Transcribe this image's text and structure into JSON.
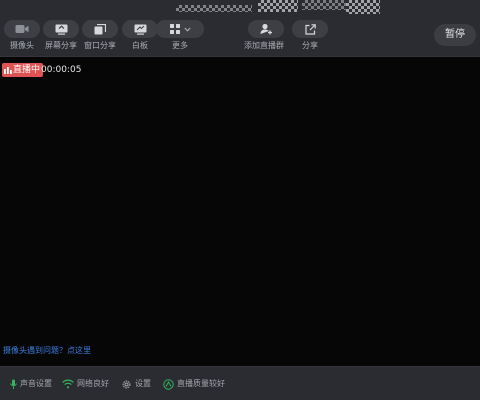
{
  "toolbar": {
    "buttons": [
      {
        "label": "摄像头",
        "icon": "camera-icon"
      },
      {
        "label": "屏幕分享",
        "icon": "screen-share-icon"
      },
      {
        "label": "窗口分享",
        "icon": "window-share-icon"
      },
      {
        "label": "白板",
        "icon": "whiteboard-icon"
      },
      {
        "label": "更多",
        "icon": "grid-icon"
      }
    ],
    "add_group_label": "添加直播群",
    "share_label": "分享",
    "pause_label": "暂停"
  },
  "live": {
    "badge_label": "直播中",
    "elapsed": "00:00:05",
    "badge_color": "#e05353"
  },
  "help_link": "摄像头遇到问题？点这里",
  "status": {
    "sound_settings": "声音设置",
    "network": "网络良好",
    "settings": "设置",
    "stream_quality": "直播质量较好"
  },
  "colors": {
    "accent_link": "#3d7ee0",
    "good_status": "#33b35c"
  }
}
